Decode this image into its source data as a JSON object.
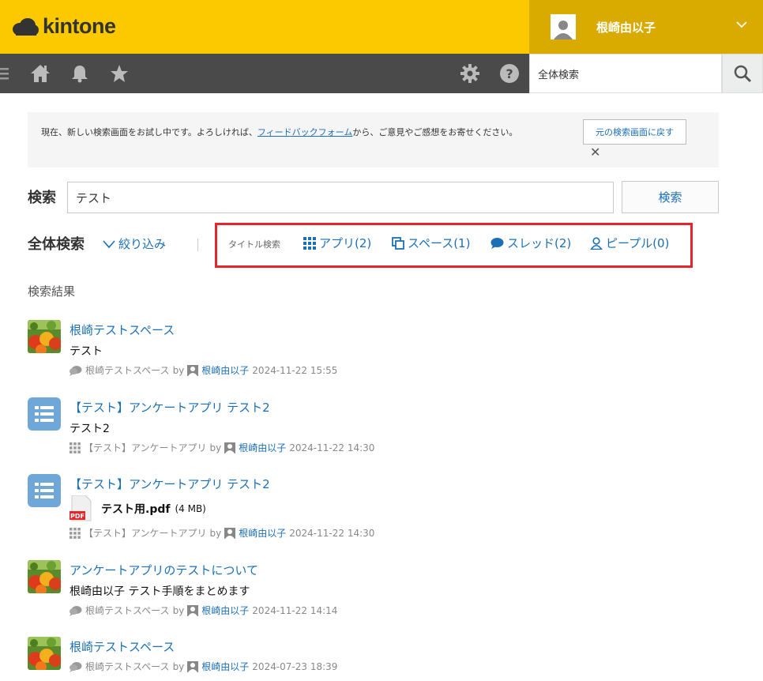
{
  "app": {
    "logo": "kintone"
  },
  "user": {
    "name": "根崎由以子"
  },
  "global_search": {
    "value": "全体検索"
  },
  "notice": {
    "text_before": "現在、新しい検索画面をお試し中です。よろしければ、",
    "link": "フィードバックフォーム",
    "text_after": "から、ご意見やご感想をお寄せください。",
    "revert_label": "元の検索画面に戻す",
    "close_label": "✕"
  },
  "search": {
    "label": "検索",
    "value": "テスト",
    "button_label": "検索"
  },
  "scope": {
    "title": "全体検索",
    "filter_label": "絞り込み",
    "title_search": "タイトル検索",
    "categories": [
      {
        "label": "アプリ(2)"
      },
      {
        "label": "スペース(1)"
      },
      {
        "label": "スレッド(2)"
      },
      {
        "label": "ピープル(0)"
      }
    ]
  },
  "results": {
    "heading": "検索結果",
    "items": [
      {
        "title": "根崎テストスペース",
        "body": "テスト",
        "source": "根崎テストスペース",
        "by": "by",
        "author": "根崎由以子",
        "date": "2024-11-22 15:55"
      },
      {
        "title": "【テスト】アンケートアプリ テスト2",
        "body": "テスト2",
        "source": "【テスト】アンケートアプリ",
        "by": "by",
        "author": "根崎由以子",
        "date": "2024-11-22 14:30"
      },
      {
        "title": "【テスト】アンケートアプリ テスト2",
        "file_name": "テスト用.pdf",
        "file_size": "(4 MB)",
        "file_badge": "PDF",
        "source": "【テスト】アンケートアプリ",
        "by": "by",
        "author": "根崎由以子",
        "date": "2024-11-22 14:30"
      },
      {
        "title": "アンケートアプリのテストについて",
        "body": "根崎由以子 テスト手順をまとめます",
        "source": "根崎テストスペース",
        "by": "by",
        "author": "根崎由以子",
        "date": "2024-11-22 14:14"
      },
      {
        "title": "根崎テストスペース",
        "source": "根崎テストスペース",
        "by": "by",
        "author": "根崎由以子",
        "date": "2024-07-23 18:39"
      }
    ]
  },
  "colors": {
    "header": "#fcc800",
    "user_box": "#d9ab00",
    "nav": "#4a4a4a",
    "link": "#1b6fb7",
    "highlight": "#e5252a"
  }
}
